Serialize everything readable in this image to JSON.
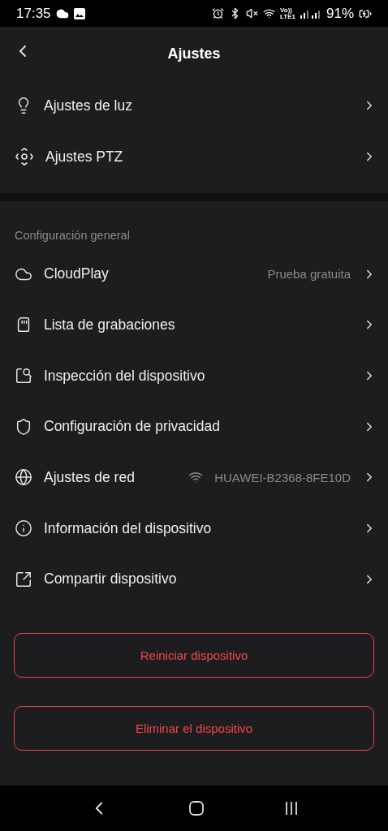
{
  "status_bar": {
    "time": "17:35",
    "volte_top": "Vo))",
    "volte_bottom": "LTE1",
    "battery": "91%"
  },
  "header": {
    "title": "Ajustes"
  },
  "top_items": [
    {
      "kind": "link",
      "label": "Ajustes de luz"
    },
    {
      "kind": "link",
      "label": "Ajustes PTZ"
    }
  ],
  "section": {
    "title": "Configuración general"
  },
  "items": [
    {
      "kind": "value",
      "label": "CloudPlay",
      "value": "Prueba gratuita"
    },
    {
      "kind": "link",
      "label": "Lista de grabaciones"
    },
    {
      "kind": "link",
      "label": "Inspección del dispositivo"
    },
    {
      "kind": "link",
      "label": "Configuración de privacidad"
    },
    {
      "kind": "network",
      "label": "Ajustes de red",
      "value": "HUAWEI-B2368-8FE10D"
    },
    {
      "kind": "link",
      "label": "Información del dispositivo"
    },
    {
      "kind": "link",
      "label": "Compartir dispositivo"
    }
  ],
  "buttons": [
    "Reiniciar dispositivo",
    "Eliminar el dispositivo"
  ]
}
